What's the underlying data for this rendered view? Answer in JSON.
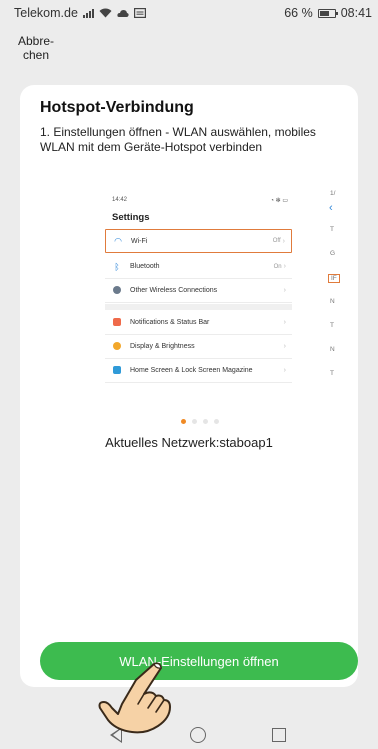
{
  "status_bar": {
    "carrier": "Telekom.de",
    "battery": "66 %",
    "time": "08:41",
    "icons": [
      "signal-icon",
      "wifi-icon",
      "cloud-icon",
      "message-icon",
      "battery-icon"
    ]
  },
  "header": {
    "cancel_label": "Abbre-\nchen"
  },
  "card": {
    "title": "Hotspot-Verbindung",
    "instructions": "1. Einstellungen öffnen - WLAN auswählen, mobiles WLAN mit dem Geräte-Hotspot verbinden",
    "network_text": "Aktuelles Netzwerk:staboap1",
    "button_label": "WLAN-Einstellungen öffnen"
  },
  "preview": {
    "time": "14:42",
    "title": "Settings",
    "rows": [
      {
        "label": "Wi-Fi",
        "value": "Off",
        "icon": "wifi-icon",
        "highlighted": true
      },
      {
        "label": "Bluetooth",
        "value": "On",
        "icon": "bluetooth-icon"
      },
      {
        "label": "Other Wireless Connections",
        "value": "",
        "icon": "connections-icon"
      },
      {
        "label": "Notifications & Status Bar",
        "value": "",
        "icon": "notifications-icon"
      },
      {
        "label": "Display & Brightness",
        "value": "",
        "icon": "display-icon"
      },
      {
        "label": "Home Screen & Lock Screen Magazine",
        "value": "",
        "icon": "homescreen-icon"
      }
    ],
    "carousel_pages": 4,
    "active_page": 1
  },
  "peek": {
    "letters": [
      "T",
      "G",
      "IF",
      "N",
      "T",
      "N",
      "T"
    ]
  },
  "colors": {
    "accent_green": "#3dbb4f",
    "highlight_orange": "#e07b3c",
    "dot_active": "#f08a24",
    "background": "#ececec"
  }
}
